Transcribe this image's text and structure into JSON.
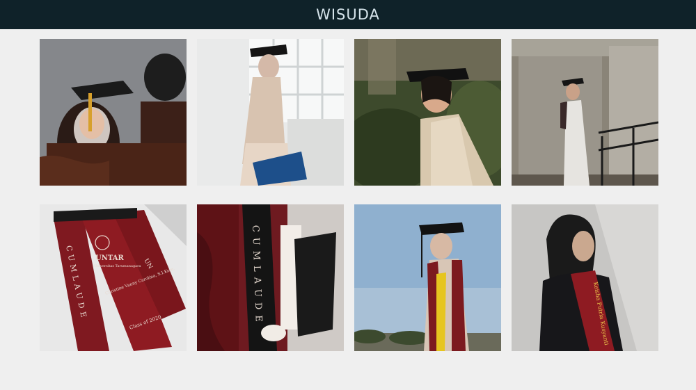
{
  "header": {
    "title": "WISUDA"
  },
  "photos": [
    {
      "id": "photo-1",
      "subject": "graduate-cap-adjusted"
    },
    {
      "id": "photo-2",
      "subject": "graduate-window-diploma"
    },
    {
      "id": "photo-3",
      "subject": "graduate-garden-portrait"
    },
    {
      "id": "photo-4",
      "subject": "graduate-stairwell"
    },
    {
      "id": "photo-5",
      "subject": "sash-cumlaude-flatlay",
      "text": {
        "sash_left": "CUMLAUDE",
        "logo": "UNTAR",
        "university": "Universitas Tarumanagara",
        "name": "Christine Vanny Carolina, S.I.Kom.",
        "class": "Class of 2020",
        "sash_right": "UN"
      }
    },
    {
      "id": "photo-6",
      "subject": "sash-cumlaude-closeup",
      "text": {
        "sash": "CUMLAUDE"
      }
    },
    {
      "id": "photo-7",
      "subject": "graduate-sky-portrait"
    },
    {
      "id": "photo-8",
      "subject": "graduate-sash-portrait",
      "text": {
        "sash": "Keisha Putria Kusyanti"
      }
    }
  ],
  "colors": {
    "header_bg": "#0f2229",
    "title": "#d5e3ea",
    "page_bg": "#efefef",
    "sash_red": "#8e1b22"
  }
}
